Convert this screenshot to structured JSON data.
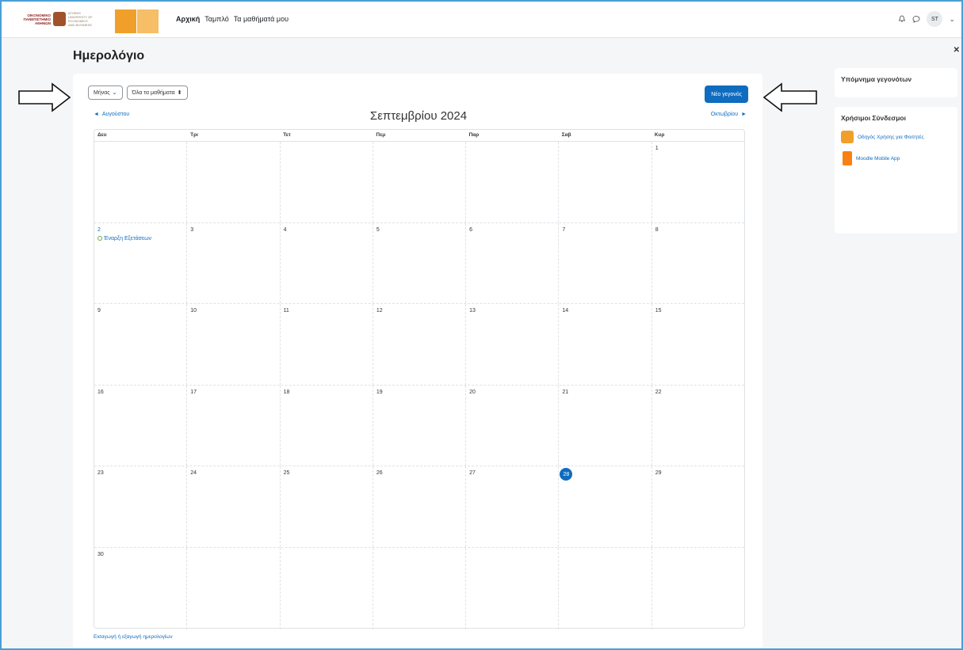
{
  "topnav": {
    "logo_text": "ΟΙΚΟΝΟΜΙΚΟ ΠΑΝΕΠΙΣΤΗΜΙΟ ΑΘΗΝΩΝ",
    "logo_sub": "ATHENS UNIVERSITY OF ECONOMICS AND BUSINESS",
    "links": [
      "Αρχική",
      "Ταμπλό",
      "Τα μαθήματά μου"
    ],
    "user_initials": "ST"
  },
  "page": {
    "title": "Ημερολόγιο"
  },
  "calendar": {
    "view_select": "Μήνας",
    "course_select": "Όλα τα μαθήματα",
    "new_event": "Νέο γεγονός",
    "prev_month": "Αυγούστου",
    "next_month": "Οκτωβρίου",
    "month_title": "Σεπτεμβρίου 2024",
    "weekdays": [
      "Δευ",
      "Τρι",
      "Τετ",
      "Πεμ",
      "Παρ",
      "Σαβ",
      "Κυρ"
    ],
    "weeks": [
      [
        "",
        "",
        "",
        "",
        "",
        "",
        "1"
      ],
      [
        "2",
        "3",
        "4",
        "5",
        "6",
        "7",
        "8"
      ],
      [
        "9",
        "10",
        "11",
        "12",
        "13",
        "14",
        "15"
      ],
      [
        "16",
        "17",
        "18",
        "19",
        "20",
        "21",
        "22"
      ],
      [
        "23",
        "24",
        "25",
        "26",
        "27",
        "28",
        "29"
      ],
      [
        "30",
        "",
        "",
        "",
        "",
        "",
        ""
      ]
    ],
    "today": "28",
    "event_label": "Έναρξη Εξετάσεων",
    "import_export": "Εισαγωγή ή εξαγωγή ημερολογίων"
  },
  "drawer": {
    "legend_title": "Υπόμνημα γεγονότων",
    "links_title": "Χρήσιμοι Σύνδεσμοι",
    "links": [
      "Οδηγός Χρήσης για Φοιτητές",
      "Moodle Mobile App"
    ]
  },
  "colors": {
    "primary": "#0f6cbf",
    "event_dot": "#6cae3e"
  }
}
